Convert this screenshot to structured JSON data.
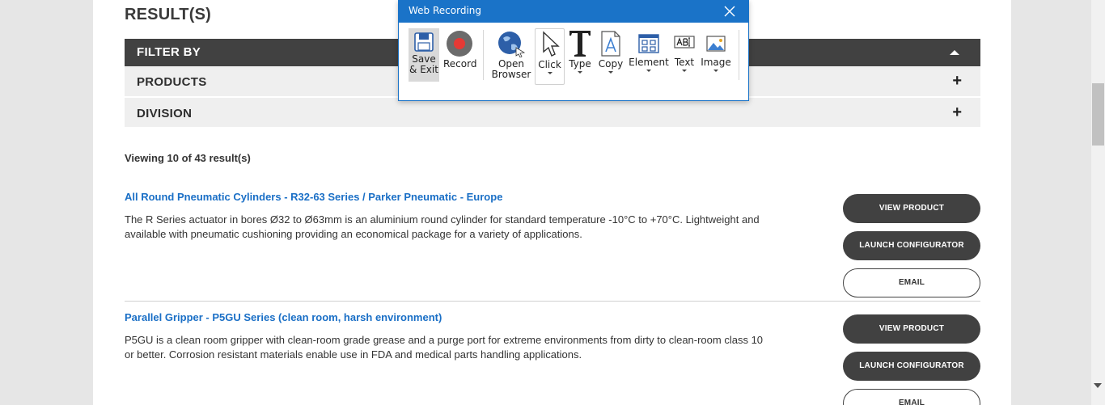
{
  "page": {
    "results_title": "RESULT(S)",
    "filter_header": "FILTER BY",
    "filters": [
      {
        "label": "PRODUCTS"
      },
      {
        "label": "DIVISION"
      }
    ],
    "viewing_text": "Viewing 10 of 43 result(s)",
    "results": [
      {
        "title": "All Round Pneumatic Cylinders - R32-63 Series / Parker Pneumatic - Europe",
        "description": "The R Series actuator in bores Ø32 to Ø63mm is an aluminium round cylinder for standard temperature -10°C to +70°C. Lightweight and available with pneumatic cushioning providing an economical package for a variety of applications.",
        "buttons": [
          "VIEW PRODUCT",
          "LAUNCH CONFIGURATOR",
          "EMAIL"
        ]
      },
      {
        "title": "Parallel Gripper - P5GU Series (clean room, harsh environment)",
        "description": "P5GU is a clean room gripper with clean-room grade grease and a purge port for extreme environments from dirty to clean-room class 10 or better. Corrosion resistant materials enable use in FDA and medical parts handling applications.",
        "buttons": [
          "VIEW PRODUCT",
          "LAUNCH CONFIGURATOR",
          "EMAIL"
        ]
      }
    ],
    "colors": {
      "link": "#1a6fc6",
      "dark_button": "#414141",
      "filter_bar": "#414141"
    }
  },
  "recorder": {
    "title": "Web Recording",
    "tools": {
      "save": {
        "label1": "Save",
        "label2": "& Exit",
        "icon": "floppy-disk-icon"
      },
      "record": {
        "label": "Record",
        "icon": "record-icon"
      },
      "browser": {
        "label1": "Open",
        "label2": "Browser",
        "icon": "globe-icon"
      },
      "click": {
        "label": "Click",
        "icon": "cursor-icon"
      },
      "type": {
        "label": "Type",
        "icon": "type-t-icon"
      },
      "copy": {
        "label": "Copy",
        "icon": "copy-document-icon"
      },
      "element": {
        "label": "Element",
        "icon": "element-grid-icon"
      },
      "text": {
        "label": "Text",
        "icon": "text-field-icon"
      },
      "image": {
        "label": "Image",
        "icon": "image-icon"
      }
    },
    "colors": {
      "titlebar": "#1a73c8",
      "record": "#e53935"
    }
  }
}
